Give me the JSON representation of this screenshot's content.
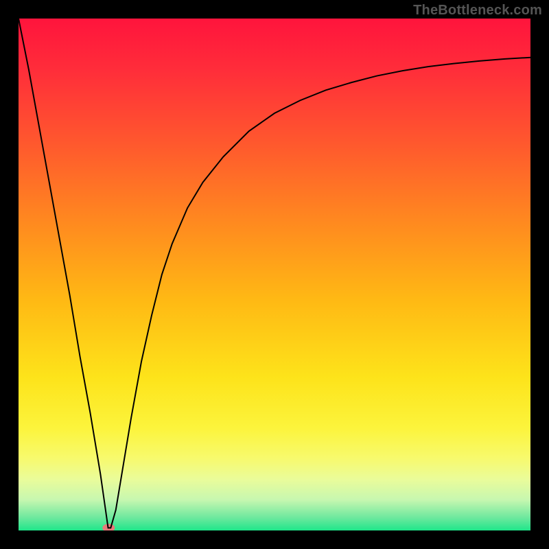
{
  "watermark": "TheBottleneck.com",
  "chart_data": {
    "type": "line",
    "xlim": [
      0,
      100
    ],
    "ylim": [
      0,
      100
    ],
    "xlabel": "",
    "ylabel": "",
    "title": "",
    "background": {
      "type": "vertical-gradient",
      "stops": [
        {
          "offset": 0.0,
          "color": "#ff143c"
        },
        {
          "offset": 0.1,
          "color": "#ff2d3a"
        },
        {
          "offset": 0.25,
          "color": "#ff5a2d"
        },
        {
          "offset": 0.4,
          "color": "#ff8a1f"
        },
        {
          "offset": 0.55,
          "color": "#ffb914"
        },
        {
          "offset": 0.7,
          "color": "#fde31a"
        },
        {
          "offset": 0.8,
          "color": "#fcf43c"
        },
        {
          "offset": 0.86,
          "color": "#f7fa6e"
        },
        {
          "offset": 0.9,
          "color": "#eafc9a"
        },
        {
          "offset": 0.94,
          "color": "#c7f7b0"
        },
        {
          "offset": 0.975,
          "color": "#6de89e"
        },
        {
          "offset": 1.0,
          "color": "#1fe68a"
        }
      ]
    },
    "series": [
      {
        "name": "bottleneck-curve",
        "color": "#000000",
        "stroke_width": 2,
        "x": [
          0,
          2,
          4,
          6,
          8,
          10,
          12,
          14,
          16,
          17,
          17.5,
          18,
          19,
          20,
          22,
          24,
          26,
          28,
          30,
          33,
          36,
          40,
          45,
          50,
          55,
          60,
          65,
          70,
          75,
          80,
          85,
          90,
          95,
          100
        ],
        "y": [
          100,
          90,
          79,
          68,
          57,
          46,
          34,
          23,
          11,
          4,
          0.5,
          0.5,
          4,
          10,
          22,
          33,
          42,
          50,
          56,
          63,
          68,
          73,
          78,
          81.5,
          84,
          86,
          87.5,
          88.8,
          89.8,
          90.6,
          91.2,
          91.7,
          92.1,
          92.4
        ]
      }
    ],
    "marker": {
      "name": "sweet-spot",
      "x": 17.6,
      "y": 0.5,
      "color": "#e77a7a",
      "radius_x": 9,
      "radius_y": 6
    }
  }
}
